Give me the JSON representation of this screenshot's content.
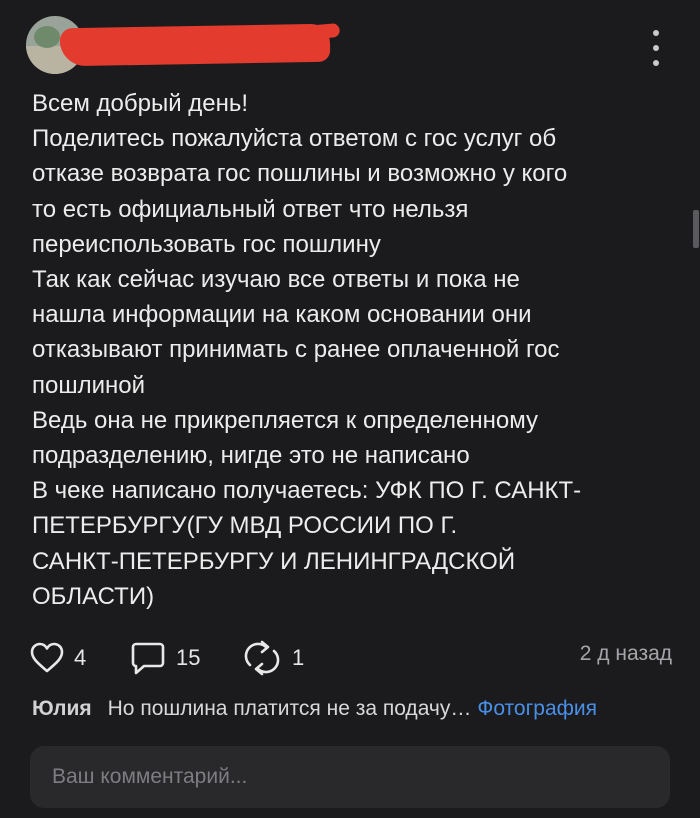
{
  "post": {
    "author_redacted": true,
    "text_lines": [
      "Всем добрый день!",
      "Поделитесь пожалуйста ответом с гос услуг об",
      "отказе возврата гос пошлины и возможно у кого",
      "то есть официальный ответ что нельзя",
      "переиспользовать гос пошлину",
      "Так как сейчас изучаю все ответы и пока не",
      "нашла информации на каком основании они",
      "отказывают принимать с ранее оплаченной гос",
      "пошлиной",
      "Ведь она не прикрепляется к определенному",
      "подразделению, нигде это не написано",
      "В чеке написано получаетесь: УФК ПО Г. САНКТ-",
      "ПЕТЕРБУРГУ(ГУ МВД РОССИИ ПО Г.",
      "САНКТ-ПЕТЕРБУРГУ И ЛЕНИНГРАДСКОЙ",
      "ОБЛАСТИ)"
    ]
  },
  "actions": {
    "likes": "4",
    "comments": "15",
    "shares": "1",
    "timestamp": "2 д назад"
  },
  "last_comment": {
    "author": "Юлия",
    "text": "Но пошлина платится не за подачу…",
    "attachment_link": "Фотография"
  },
  "comment_input": {
    "placeholder": "Ваш комментарий..."
  },
  "icons": {
    "like": "heart-icon",
    "comments": "comment-bubble-icon",
    "shares": "repost-icon",
    "more": "more-vertical-icon"
  },
  "colors": {
    "background": "#1b1b1d",
    "link": "#4a8fe7",
    "redaction": "#e33b2e"
  }
}
